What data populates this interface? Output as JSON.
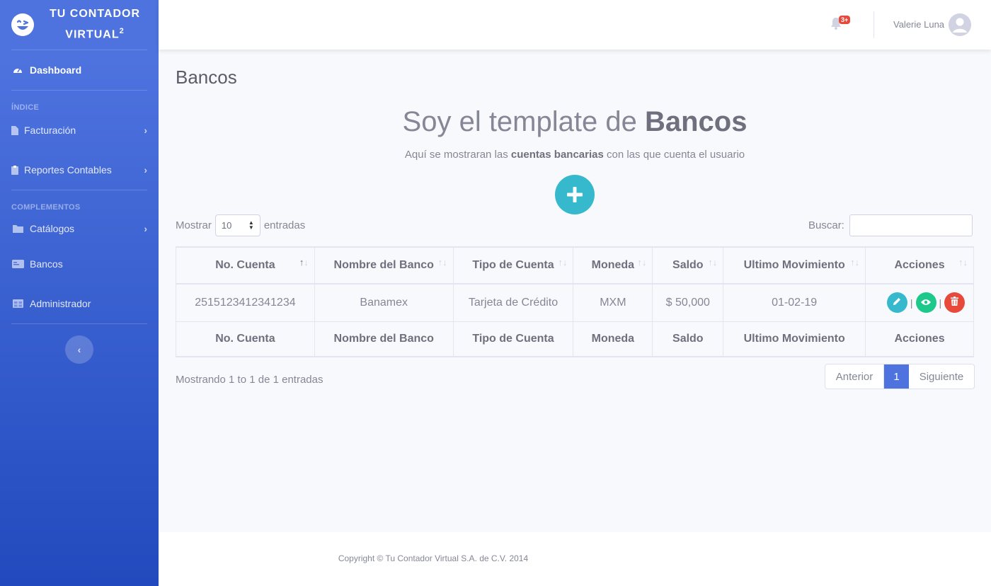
{
  "brand": {
    "line1": "TU CONTADOR",
    "line2": "VIRTUAL",
    "sup": "2"
  },
  "sidebar": {
    "dashboard": "Dashboard",
    "heading_indice": "ÍNDICE",
    "facturacion": "Facturación",
    "reportes": "Reportes Contables",
    "heading_complementos": "COMPLEMENTOS",
    "catalogos": "Catálogos",
    "bancos": "Bancos",
    "administrador": "Administrador"
  },
  "topbar": {
    "badge": "3+",
    "user": "Valerie Luna"
  },
  "page": {
    "title": "Bancos",
    "hero_prefix": "Soy el template de ",
    "hero_bold": "Bancos",
    "sub_prefix": "Aquí se mostraran las ",
    "sub_bold": "cuentas bancarias",
    "sub_suffix": " con las que cuenta el usuario"
  },
  "table_controls": {
    "show_label": "Mostrar",
    "length_value": "10",
    "entries_label": "entradas",
    "search_label": "Buscar:",
    "search_value": ""
  },
  "table": {
    "columns": [
      "No. Cuenta",
      "Nombre del Banco",
      "Tipo de Cuenta",
      "Moneda",
      "Saldo",
      "Ultimo Movimiento",
      "Acciones"
    ],
    "rows": [
      [
        "2515123412341234",
        "Banamex",
        "Tarjeta de Crédito",
        "MXM",
        "$ 50,000",
        "01-02-19"
      ]
    ],
    "separator": "|"
  },
  "pagination": {
    "info": "Mostrando 1 to 1 de 1 entradas",
    "prev": "Anterior",
    "current": "1",
    "next": "Siguiente"
  },
  "footer": {
    "text": "Copyright © Tu Contador Virtual S.A. de C.V. 2014"
  },
  "colors": {
    "primary": "#4e73df",
    "info": "#36b9cc",
    "success": "#1cc88a",
    "danger": "#e74a3b"
  },
  "icons": [
    "wink-logo-icon",
    "tachometer-icon",
    "file-icon",
    "clipboard-icon",
    "folder-icon",
    "id-card-icon",
    "table-icon",
    "chevron-right-icon",
    "chevron-left-icon",
    "bell-icon",
    "user-avatar-icon",
    "plus-icon",
    "pencil-icon",
    "eye-icon",
    "trash-icon",
    "sort-icon"
  ]
}
